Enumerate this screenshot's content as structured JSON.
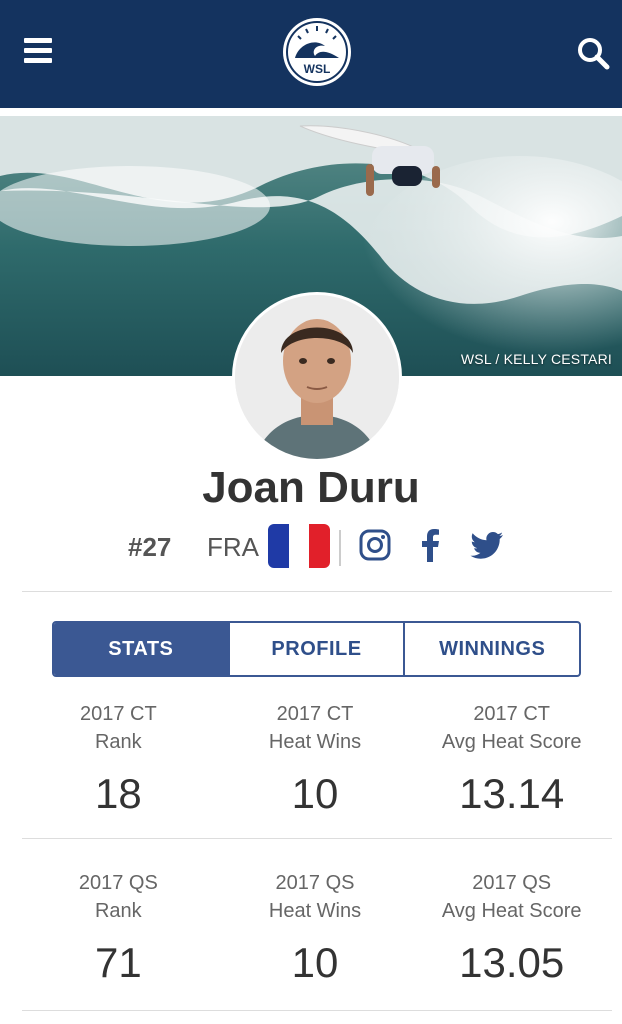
{
  "header": {
    "logo_text": "WSL",
    "menu_icon": "hamburger-menu-icon",
    "search_icon": "search-icon",
    "bg_color": "#14335f"
  },
  "hero": {
    "credit": "WSL / KELLY CESTARI"
  },
  "athlete": {
    "name": "Joan Duru",
    "rank": "#27",
    "country": "FRA",
    "flag_colors": [
      "#1f3aa6",
      "#ffffff",
      "#e1202a"
    ]
  },
  "social": {
    "instagram_icon": "instagram-icon",
    "facebook_icon": "facebook-icon",
    "twitter_icon": "twitter-icon",
    "color": "#2f4f8a"
  },
  "tabs": [
    {
      "label": "STATS",
      "active": true
    },
    {
      "label": "PROFILE",
      "active": false
    },
    {
      "label": "WINNINGS",
      "active": false
    }
  ],
  "stats": [
    [
      {
        "line1": "2017 CT",
        "line2": "Rank",
        "value": "18"
      },
      {
        "line1": "2017 CT",
        "line2": "Heat Wins",
        "value": "10"
      },
      {
        "line1": "2017 CT",
        "line2": "Avg Heat Score",
        "value": "13.14"
      }
    ],
    [
      {
        "line1": "2017 QS",
        "line2": "Rank",
        "value": "71"
      },
      {
        "line1": "2017 QS",
        "line2": "Heat Wins",
        "value": "10"
      },
      {
        "line1": "2017 QS",
        "line2": "Avg Heat Score",
        "value": "13.05"
      }
    ]
  ],
  "accent_color": "#3b5893"
}
